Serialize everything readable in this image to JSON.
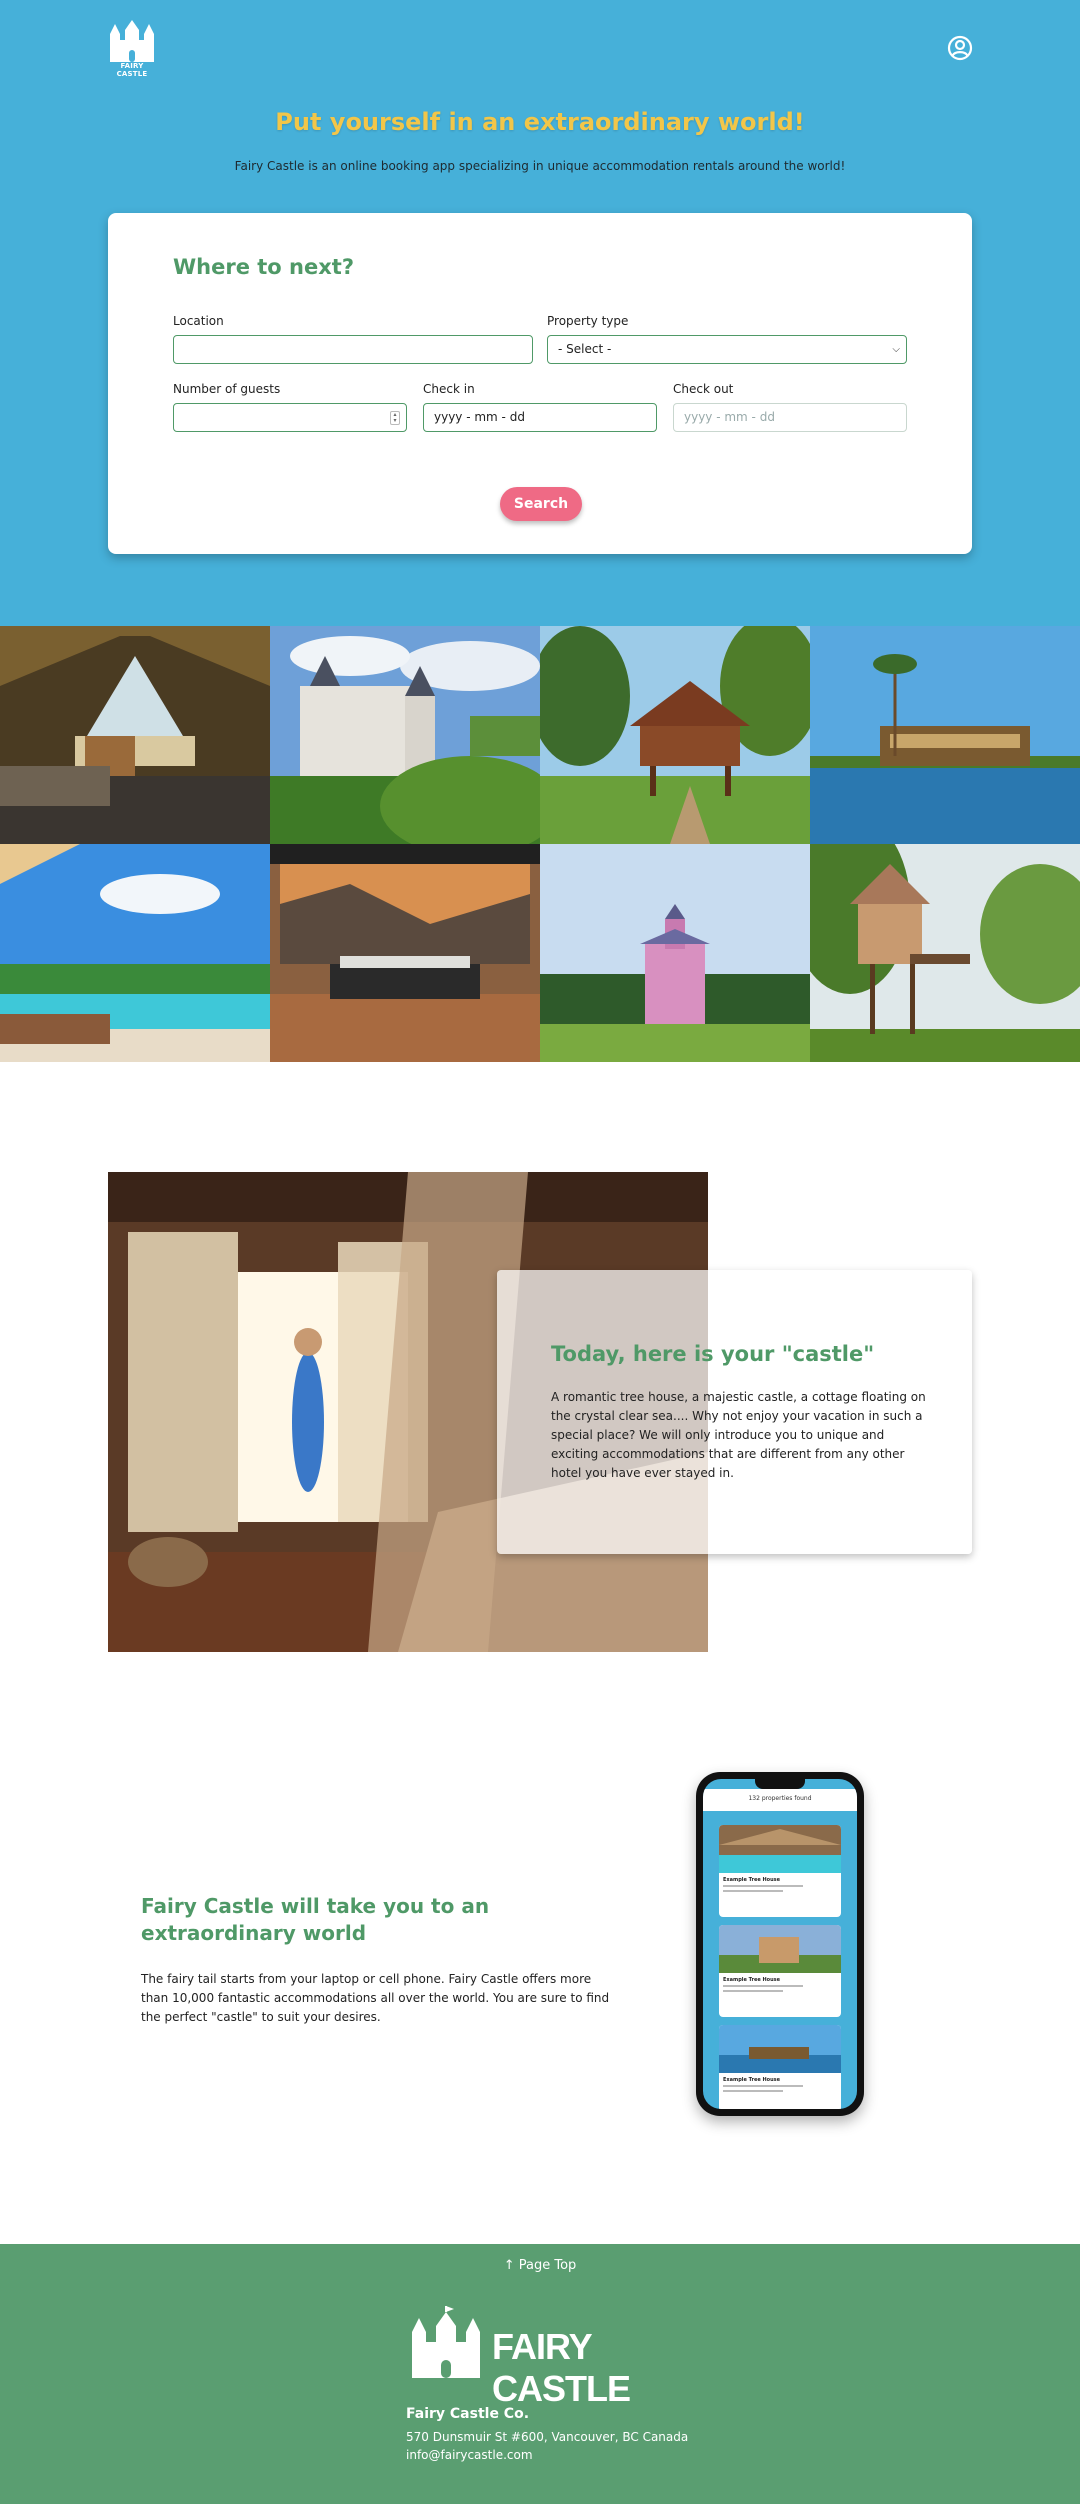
{
  "brand": {
    "logo_text": "FAIRY CASTLE"
  },
  "hero": {
    "title": "Put yourself in an extraordinary world!",
    "subtitle": "Fairy Castle is an online booking app specializing in unique accommodation rentals around the world!"
  },
  "search": {
    "heading": "Where to next?",
    "location_label": "Location",
    "location_value": "",
    "property_type_label": "Property type",
    "property_type_value": "- Select -",
    "guests_label": "Number of guests",
    "guests_value": "",
    "checkin_label": "Check in",
    "checkin_value": "yyyy - mm - dd",
    "checkout_label": "Check out",
    "checkout_placeholder": "yyyy - mm - dd",
    "button_label": "Search"
  },
  "gallery": {
    "images": [
      "glamping-tent",
      "castle",
      "stilt-house",
      "houseboat",
      "resort-pool",
      "modern-bed",
      "pink-mansion",
      "tree-house"
    ]
  },
  "story": {
    "title": "Today, here is your \"castle\"",
    "text": "A romantic tree house, a majestic castle, a cottage floating on the crystal clear sea.... Why not enjoy your vacation in such a special place? We will only introduce you to unique and exciting accommodations that are different from any other hotel you have ever stayed in."
  },
  "promo": {
    "title": "Fairy Castle will take you to an extraordinary world",
    "text": "The fairy tail starts from your laptop or cell phone. Fairy Castle offers more than 10,000 fantastic accommodations all over the world. You are sure to find the perfect \"castle\" to suit your desires.",
    "phone_count": "132 properties found",
    "phone_card_name": "Example Tree House"
  },
  "footer": {
    "page_top": "Page Top",
    "logo_text": "FAIRY CASTLE",
    "company": "Fairy Castle Co.",
    "address": "570 Dunsmuir St #600, Vancouver, BC Canada",
    "email": "info@fairycastle.com"
  },
  "colors": {
    "hero_bg": "#46b0d9",
    "title_yellow": "#f2c649",
    "brand_green": "#4f9967",
    "button_pink": "#ef6a85",
    "footer_green": "#5a9e71"
  }
}
